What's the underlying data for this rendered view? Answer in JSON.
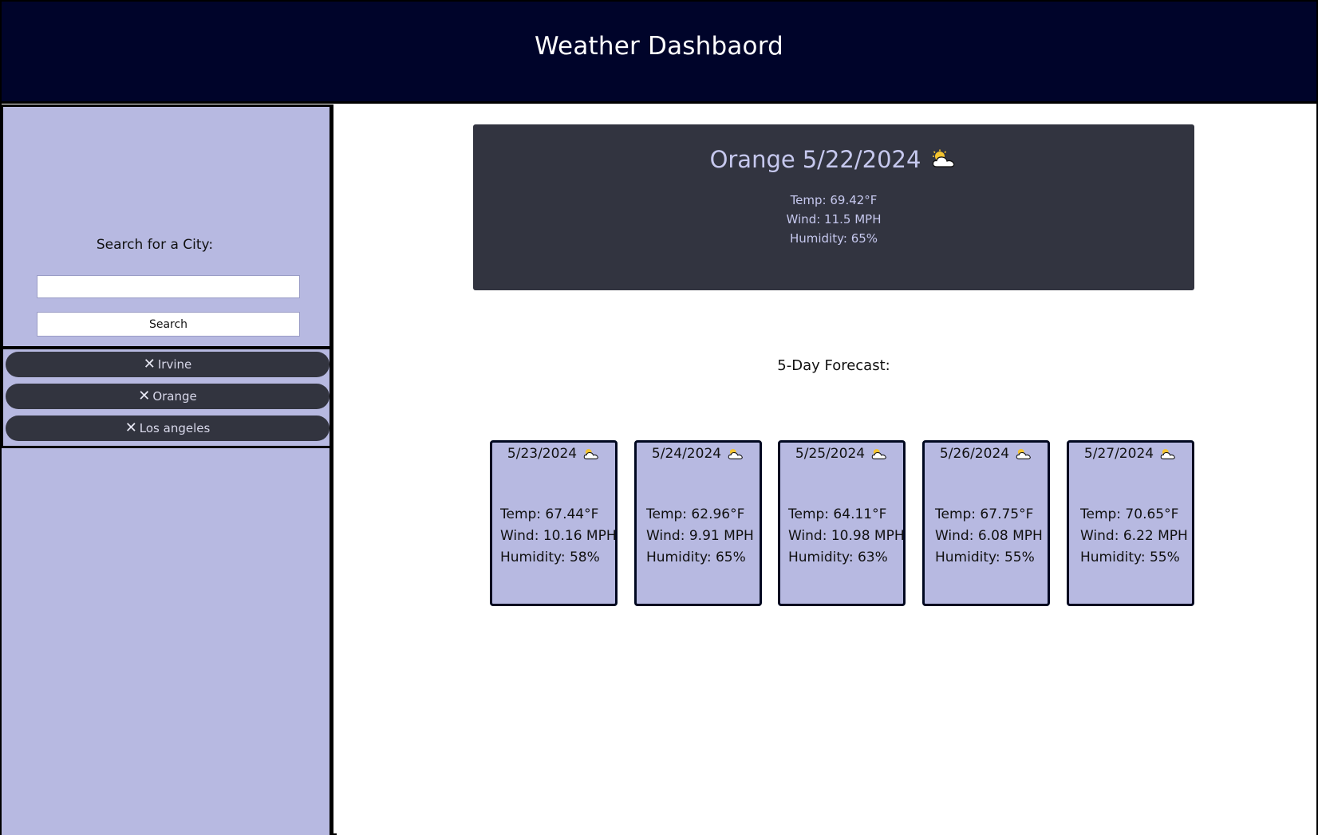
{
  "header": {
    "title": "Weather Dashbaord"
  },
  "sidebar": {
    "search_label": "Search for a City:",
    "search_value": "",
    "search_placeholder": "",
    "search_button": "Search",
    "history": [
      {
        "label": "Irvine",
        "remove_glyph": "✕"
      },
      {
        "label": "Orange",
        "remove_glyph": "✕"
      },
      {
        "label": "Los angeles",
        "remove_glyph": "✕"
      }
    ]
  },
  "current": {
    "city": "Orange",
    "date": "5/22/2024",
    "icon": "partly-cloudy-icon",
    "temp": "Temp: 69.42°F",
    "wind": "Wind: 11.5 MPH",
    "humidity": "Humidity: 65%"
  },
  "forecast": {
    "title": "5-Day Forecast:",
    "days": [
      {
        "date": "5/23/2024",
        "icon": "partly-cloudy-icon",
        "temp": "Temp: 67.44°F",
        "wind": "Wind: 10.16 MPH",
        "humidity": "Humidity: 58%"
      },
      {
        "date": "5/24/2024",
        "icon": "partly-cloudy-icon",
        "temp": "Temp: 62.96°F",
        "wind": "Wind: 9.91 MPH",
        "humidity": "Humidity: 65%"
      },
      {
        "date": "5/25/2024",
        "icon": "partly-cloudy-icon",
        "temp": "Temp: 64.11°F",
        "wind": "Wind: 10.98 MPH",
        "humidity": "Humidity: 63%"
      },
      {
        "date": "5/26/2024",
        "icon": "partly-cloudy-icon",
        "temp": "Temp: 67.75°F",
        "wind": "Wind: 6.08 MPH",
        "humidity": "Humidity: 55%"
      },
      {
        "date": "5/27/2024",
        "icon": "partly-cloudy-icon",
        "temp": "Temp: 70.65°F",
        "wind": "Wind: 6.22 MPH",
        "humidity": "Humidity: 55%"
      }
    ]
  },
  "colors": {
    "header_bg": "#00042a",
    "sidebar_bg": "#b7b9e1",
    "dark_panel": "#323440",
    "panel_text": "#c6c8ee"
  }
}
